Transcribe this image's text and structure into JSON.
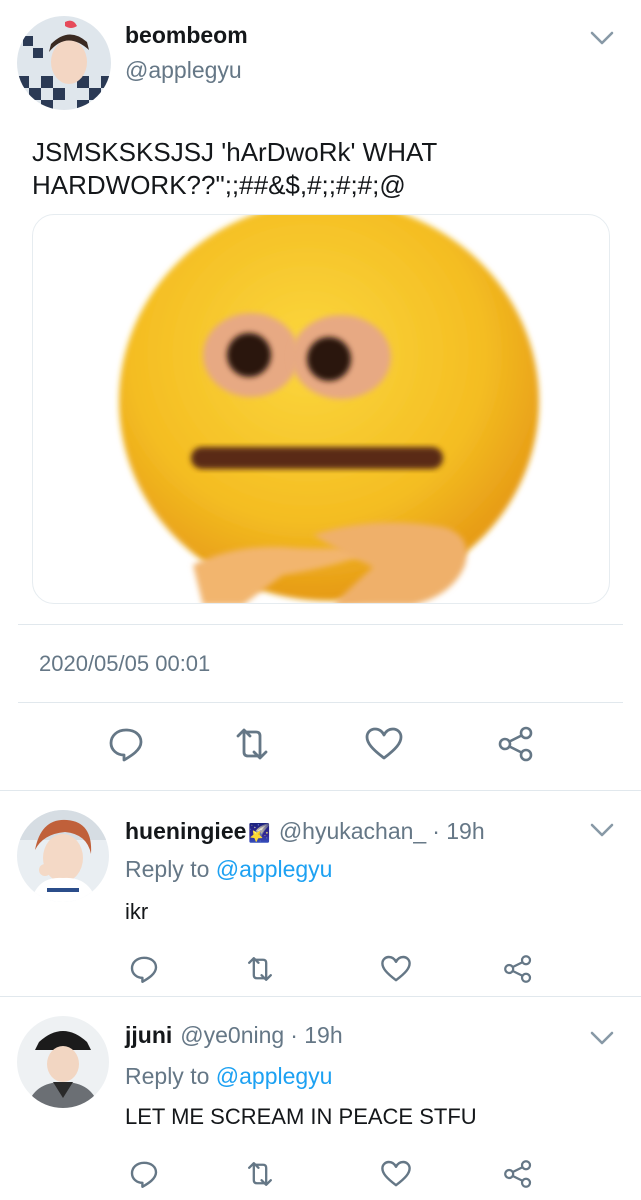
{
  "main_tweet": {
    "display_name": "beombeom",
    "handle": "@applegyu",
    "text": "JSMSKSKSJSJ 'hArDwoRk' WHAT\nHARDWORK??\";;##&$,#;;#;#;@",
    "timestamp": "2020/05/05 00:01",
    "actions": [
      "reply-icon",
      "retweet-icon",
      "like-icon",
      "share-icon"
    ]
  },
  "replies": [
    {
      "display_name": "hueningiee",
      "badge": "🌠",
      "handle": "@hyukachan_",
      "time": "· 19h",
      "reply_to_prefix": "Reply to ",
      "reply_to_handle": "@applegyu",
      "text": "ikr"
    },
    {
      "display_name": "jjuni",
      "handle": "@ye0ning",
      "time": "· 19h",
      "reply_to_prefix": "Reply to ",
      "reply_to_handle": "@applegyu",
      "text": "LET ME SCREAM IN PEACE STFU"
    }
  ],
  "colors": {
    "text": "#14171a",
    "secondary": "#657786",
    "link": "#1da1f2",
    "divider": "#e1e8ed",
    "emoji_yellow": "#f5c52c"
  }
}
